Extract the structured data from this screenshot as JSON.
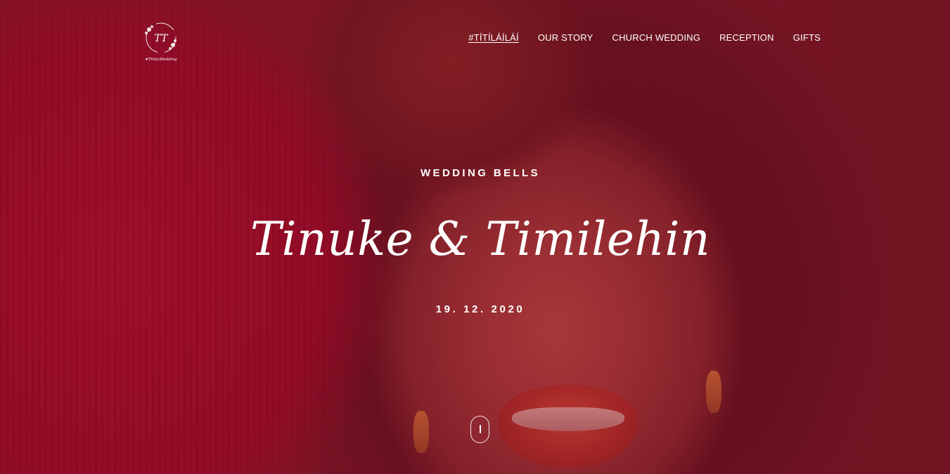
{
  "brand": {
    "logo_monogram": "TT",
    "logo_tagline": "#TitilaiWedding"
  },
  "nav": {
    "items": [
      {
        "label": "#TÍTÍLÁÍLÁÍ",
        "active": true
      },
      {
        "label": "OUR STORY",
        "active": false
      },
      {
        "label": "CHURCH WEDDING",
        "active": false
      },
      {
        "label": "RECEPTION",
        "active": false
      },
      {
        "label": "GIFTS",
        "active": false
      }
    ]
  },
  "hero": {
    "kicker": "WEDDING BELLS",
    "names": "Tinuke & Timilehin",
    "date": "19. 12. 2020",
    "overlay_color": "#780a1e",
    "scroll_icon": "mouse-scroll-icon"
  },
  "colors": {
    "text": "#ffffff",
    "tint": "#8e1a2c"
  }
}
